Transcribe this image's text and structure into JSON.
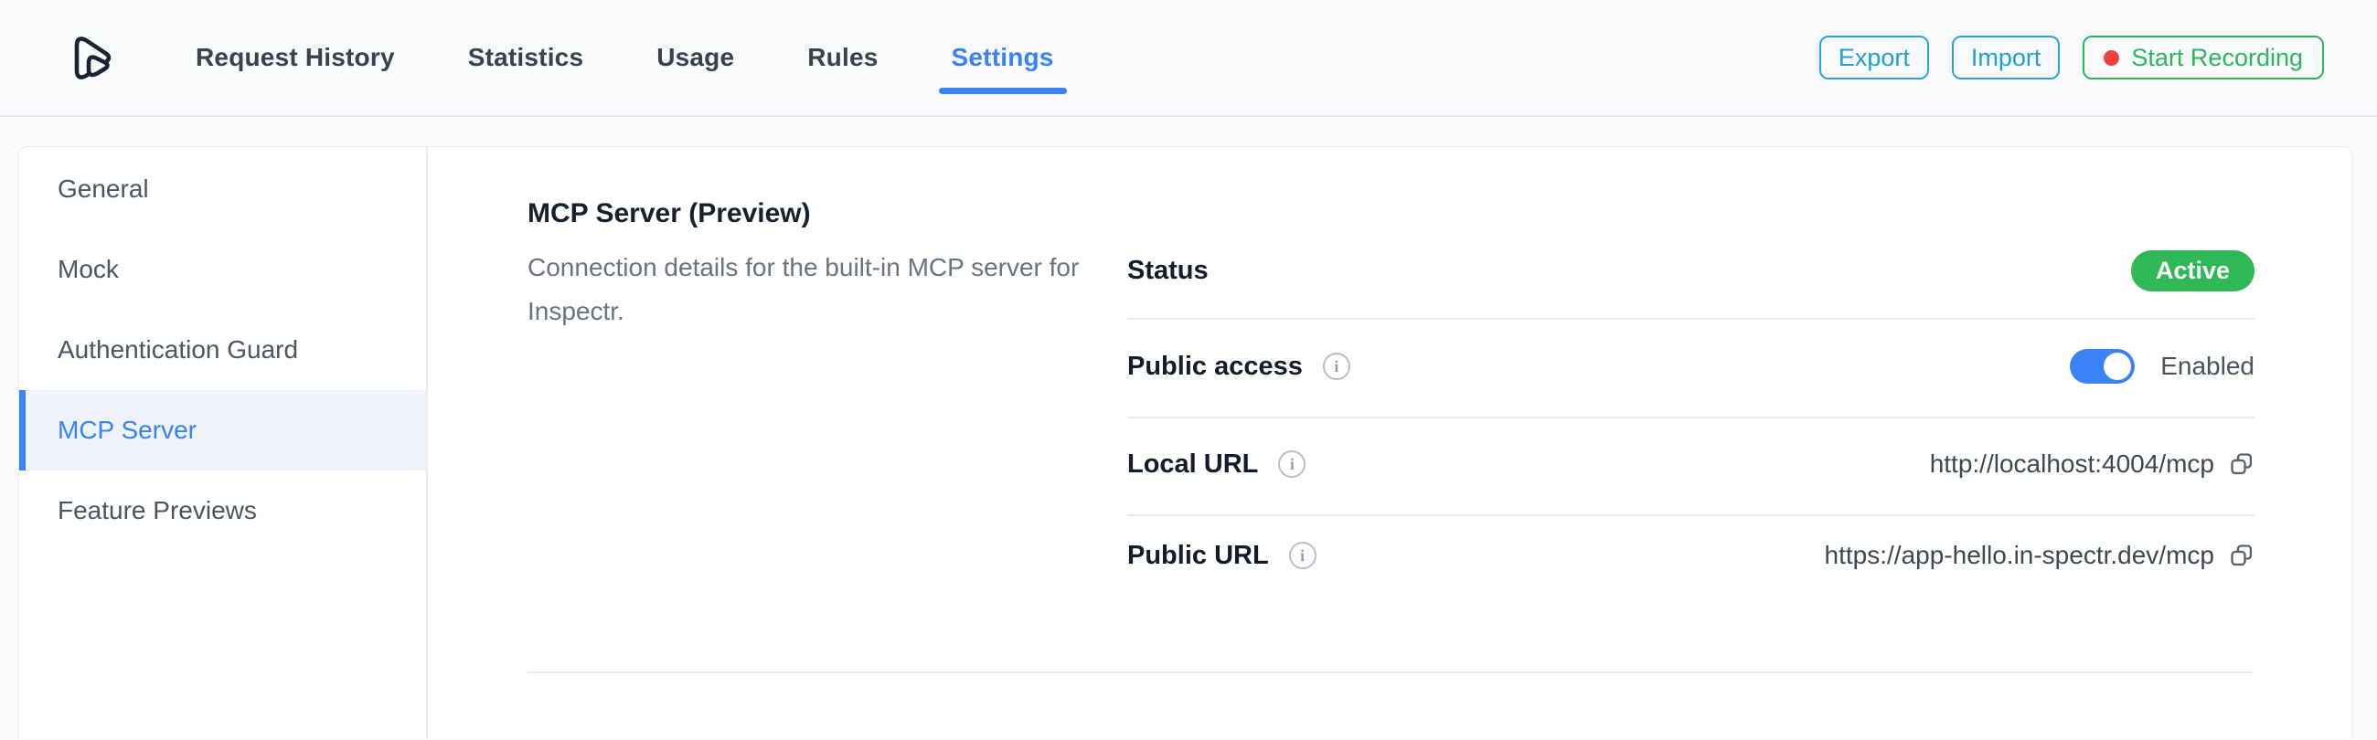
{
  "header": {
    "tabs": [
      {
        "label": "Request History",
        "active": false
      },
      {
        "label": "Statistics",
        "active": false
      },
      {
        "label": "Usage",
        "active": false
      },
      {
        "label": "Rules",
        "active": false
      },
      {
        "label": "Settings",
        "active": true
      }
    ],
    "actions": {
      "export_label": "Export",
      "import_label": "Import",
      "record_label": "Start Recording"
    }
  },
  "sidebar": {
    "items": [
      {
        "label": "General",
        "active": false
      },
      {
        "label": "Mock",
        "active": false
      },
      {
        "label": "Authentication Guard",
        "active": false
      },
      {
        "label": "MCP Server",
        "active": true
      },
      {
        "label": "Feature Previews",
        "active": false
      }
    ]
  },
  "main": {
    "section": {
      "title": "MCP Server (Preview)",
      "description": "Connection details for the built-in MCP server for Inspectr.",
      "rows": [
        {
          "label": "Status",
          "type": "badge",
          "value": "Active"
        },
        {
          "label": "Public access",
          "type": "toggle",
          "value": "Enabled",
          "enabled": true,
          "info_icon": "i"
        },
        {
          "label": "Local URL",
          "type": "url",
          "value": "http://localhost:4004/mcp",
          "info_icon": "i"
        },
        {
          "label": "Public URL",
          "type": "url",
          "value": "https://app-hello.in-spectr.dev/mcp",
          "info_icon": "i"
        }
      ]
    }
  },
  "icons": {
    "logo": "inspectr-play-logo",
    "info": "info-circle-icon",
    "copy": "copy-icon",
    "record_dot": "red-dot-icon"
  },
  "colors": {
    "accent_blue": "#3b82f6",
    "badge_green": "#2eb956",
    "record_green": "#2db55f",
    "record_dot_red": "#ee4040",
    "export_import_cyan": "#219fd8",
    "page_bg": "#f8fafc",
    "card_bg": "#ffffff",
    "divider": "#e8eaee",
    "label_dark": "#141c2b",
    "text_gray": "#6b7280"
  }
}
